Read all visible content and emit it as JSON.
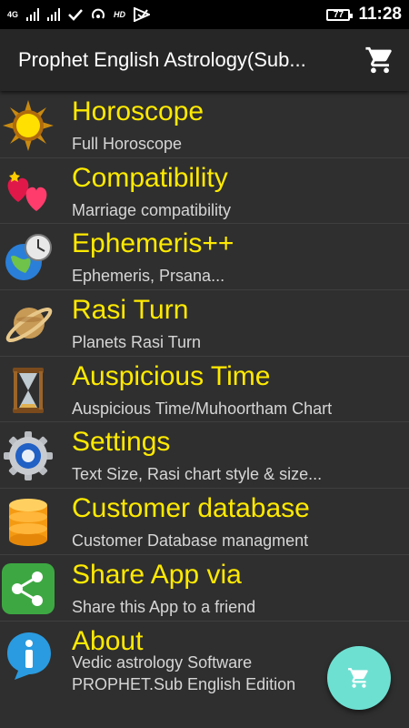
{
  "status_bar": {
    "network_tag": "4G",
    "hd_label": "HD",
    "battery": "77",
    "time": "11:28"
  },
  "app_bar": {
    "title": "Prophet English Astrology(Sub...",
    "cart_icon": "shopping-cart-icon"
  },
  "menu": [
    {
      "title": "Horoscope",
      "subtitle": "Full Horoscope",
      "icon": "sun-icon"
    },
    {
      "title": "Compatibility",
      "subtitle": "Marriage compatibility",
      "icon": "hearts-icon"
    },
    {
      "title": "Ephemeris++",
      "subtitle": "Ephemeris, Prsana...",
      "icon": "globe-clock-icon"
    },
    {
      "title": "Rasi Turn",
      "subtitle": "Planets Rasi Turn",
      "icon": "saturn-icon"
    },
    {
      "title": "Auspicious Time",
      "subtitle": "Auspicious Time/Muhoortham Chart",
      "icon": "hourglass-icon"
    },
    {
      "title": "Settings",
      "subtitle": "Text Size, Rasi chart style & size...",
      "icon": "gear-icon"
    },
    {
      "title": "Customer database",
      "subtitle": "Customer Database managment",
      "icon": "database-icon"
    },
    {
      "title": "Share App via",
      "subtitle": "Share this App to a friend",
      "icon": "share-icon"
    },
    {
      "title": "About",
      "subtitle_line1": "Vedic astrology Software",
      "subtitle_line2": "PROPHET.Sub English Edition",
      "icon": "info-icon"
    }
  ],
  "fab": {
    "icon": "cart-icon"
  },
  "colors": {
    "title_yellow": "#ffea00",
    "background": "#2f2f2f",
    "app_bar": "#262626",
    "fab": "#6ee0d2"
  }
}
